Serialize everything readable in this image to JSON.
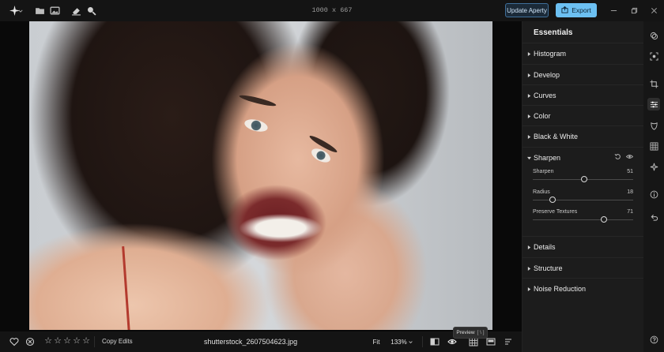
{
  "topbar": {
    "dimensions": "1000 x 667",
    "update_label": "Update Aperty",
    "export_label": "Export"
  },
  "bottombar": {
    "rating_stars": [
      "☆",
      "☆",
      "☆",
      "☆",
      "☆"
    ],
    "copy_edits_label": "Copy Edits",
    "filename": "shutterstock_2607504623.jpg",
    "fit_label": "Fit",
    "zoom_label": "133%",
    "tooltip_label": "Preview",
    "tooltip_key": "[ \\ ]"
  },
  "panel": {
    "title": "Essentials",
    "sections": {
      "histogram": "Histogram",
      "develop": "Develop",
      "curves": "Curves",
      "color": "Color",
      "black_white": "Black & White",
      "sharpen": "Sharpen",
      "details": "Details",
      "structure": "Structure",
      "noise_reduction": "Noise Reduction"
    },
    "sharpen_sliders": [
      {
        "label": "Sharpen",
        "value": "51",
        "fraction": 0.51
      },
      {
        "label": "Radius",
        "value": "18",
        "fraction": 0.2
      },
      {
        "label": "Preserve Textures",
        "value": "71",
        "fraction": 0.71
      }
    ]
  },
  "colors": {
    "accent": "#6cc0f2",
    "panel_bg": "#1c1c1c",
    "app_bg": "#141414"
  },
  "icons": {
    "top_left": [
      "app-logo-icon",
      "folder-icon",
      "image-icon",
      "eraser-icon",
      "zoom-icon"
    ],
    "right_toolbar": [
      "layers-icon",
      "selection-icon",
      "crop-icon",
      "adjustments-icon",
      "mask-icon",
      "grid-icon",
      "magic-icon",
      "info-icon",
      "history-icon",
      "help-icon"
    ]
  }
}
